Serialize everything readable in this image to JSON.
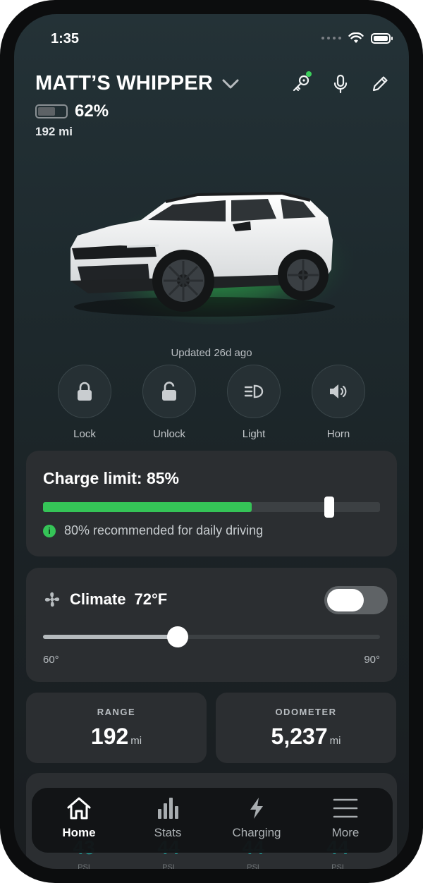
{
  "status_bar": {
    "time": "1:35"
  },
  "header": {
    "vehicle_name": "MATT’S WHIPPER",
    "battery_percent": "62%",
    "battery_level": 0.62,
    "range": "192 mi"
  },
  "vehicle": {
    "updated": "Updated 26d ago"
  },
  "quick_actions": [
    {
      "label": "Lock",
      "icon": "lock-icon"
    },
    {
      "label": "Unlock",
      "icon": "unlock-icon"
    },
    {
      "label": "Light",
      "icon": "headlight-icon"
    },
    {
      "label": "Horn",
      "icon": "speaker-icon"
    }
  ],
  "charge": {
    "title": "Charge limit: 85%",
    "level": 0.85,
    "current_level": 0.62,
    "note": "80% recommended for daily driving",
    "accent_color": "#35c457"
  },
  "climate": {
    "title": "Climate",
    "temp": "72°F",
    "enabled": false,
    "min_label": "60°",
    "max_label": "90°",
    "min": 60,
    "max": 90,
    "value": 72
  },
  "stats": {
    "range_label": "RANGE",
    "range_value": "192",
    "range_unit": "mi",
    "odometer_label": "ODOMETER",
    "odometer_value": "5,237",
    "odometer_unit": "mi"
  },
  "tires": {
    "values": [
      "43",
      "44",
      "44",
      "44"
    ],
    "unit": "PSI",
    "accent_color": "#1ea6a0"
  },
  "tabs": [
    {
      "label": "Home",
      "icon": "home-icon",
      "active": true
    },
    {
      "label": "Stats",
      "icon": "bar-chart-icon",
      "active": false
    },
    {
      "label": "Charging",
      "icon": "lightning-icon",
      "active": false
    },
    {
      "label": "More",
      "icon": "menu-icon",
      "active": false
    }
  ]
}
